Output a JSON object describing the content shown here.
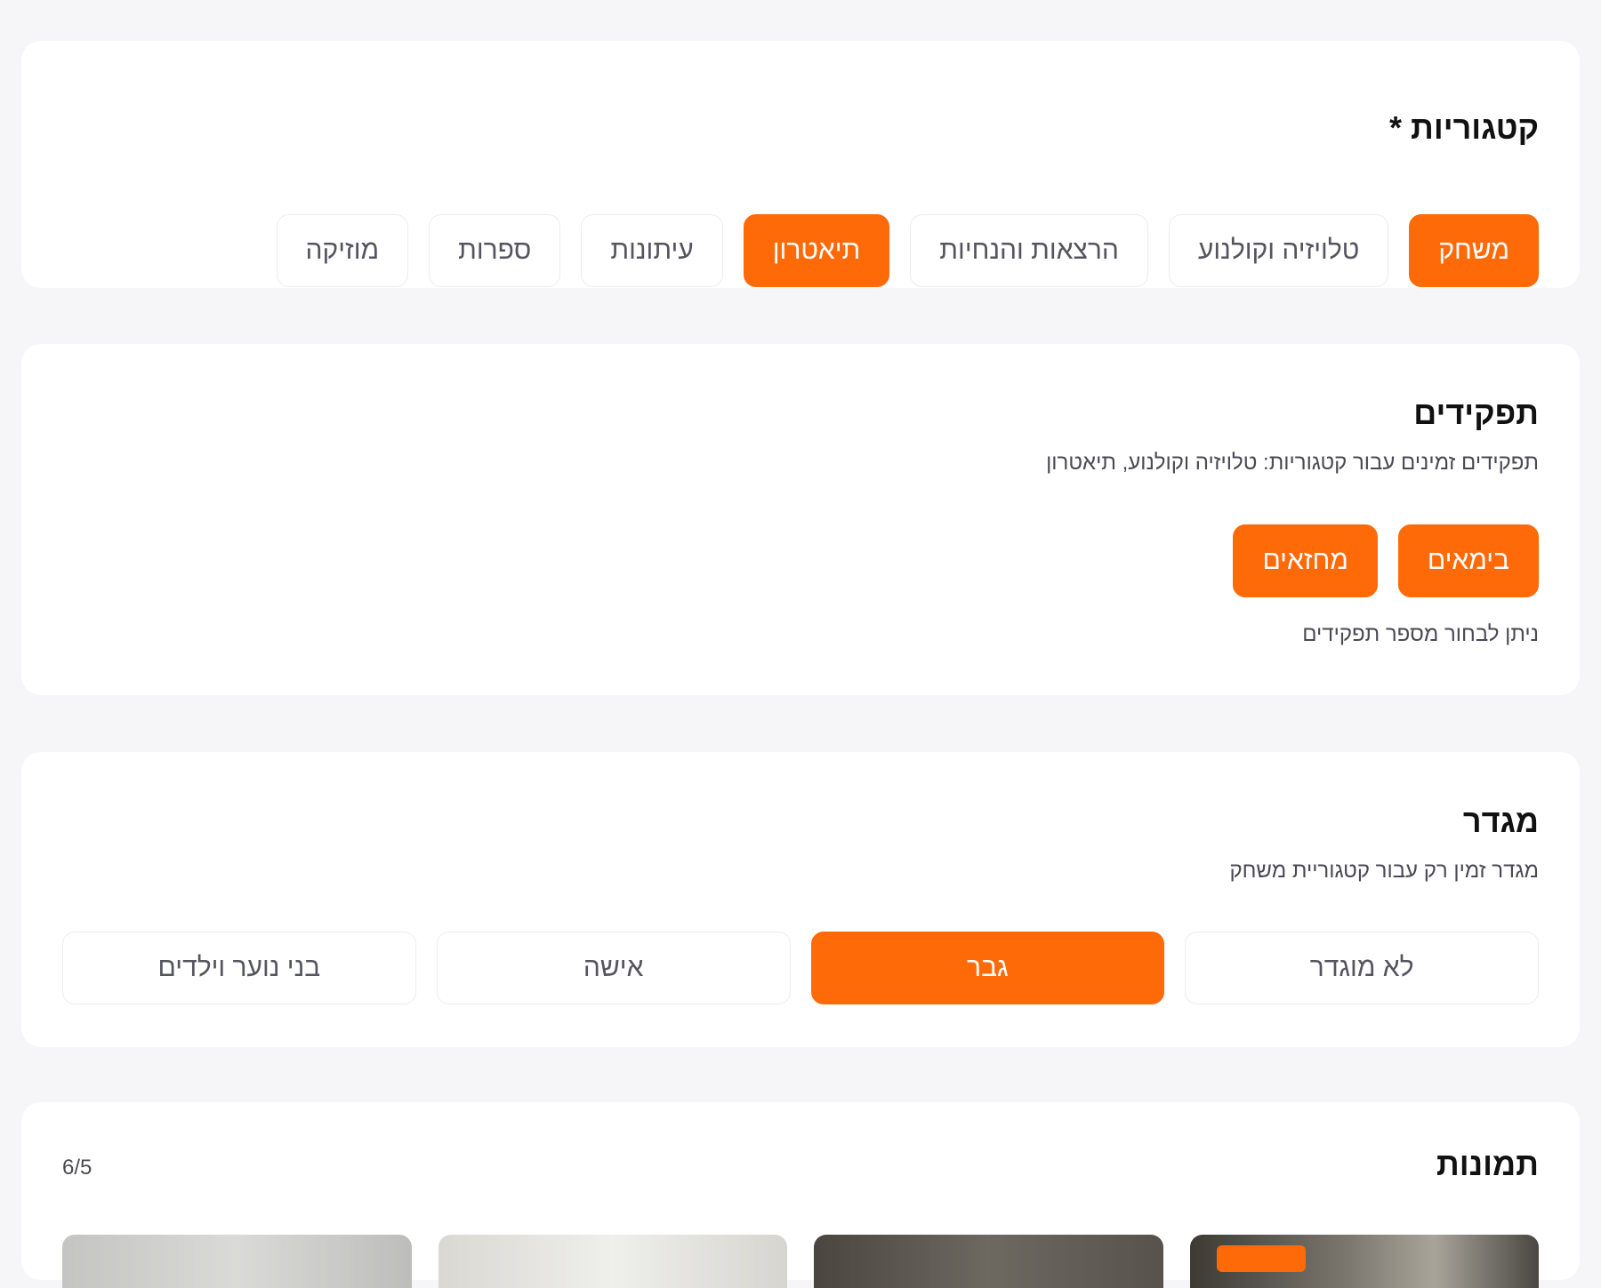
{
  "categories": {
    "title": "קטגוריות",
    "required_mark": "*",
    "items": [
      {
        "label": "משחק",
        "selected": true
      },
      {
        "label": "טלויזיה וקולנוע",
        "selected": false
      },
      {
        "label": "הרצאות והנחיות",
        "selected": false
      },
      {
        "label": "תיאטרון",
        "selected": true
      },
      {
        "label": "עיתונות",
        "selected": false
      },
      {
        "label": "ספרות",
        "selected": false
      },
      {
        "label": "מוזיקה",
        "selected": false
      }
    ]
  },
  "roles": {
    "title": "תפקידים",
    "subtitle": "תפקידים זמינים עבור קטגוריות: טלויזיה וקולנוע, תיאטרון",
    "items": [
      {
        "label": "בימאים",
        "selected": true
      },
      {
        "label": "מחזאים",
        "selected": true
      }
    ],
    "hint": "ניתן לבחור מספר תפקידים"
  },
  "gender": {
    "title": "מגדר",
    "subtitle": "מגדר זמין רק עבור קטגוריית משחק",
    "items": [
      {
        "label": "לא מוגדר",
        "selected": false
      },
      {
        "label": "גבר",
        "selected": true
      },
      {
        "label": "אישה",
        "selected": false
      },
      {
        "label": "בני נוער וילדים",
        "selected": false
      }
    ]
  },
  "photos": {
    "title": "תמונות",
    "count": "6/5"
  },
  "colors": {
    "accent": "#ff6a08",
    "background": "#f6f6f8",
    "card": "#ffffff"
  }
}
